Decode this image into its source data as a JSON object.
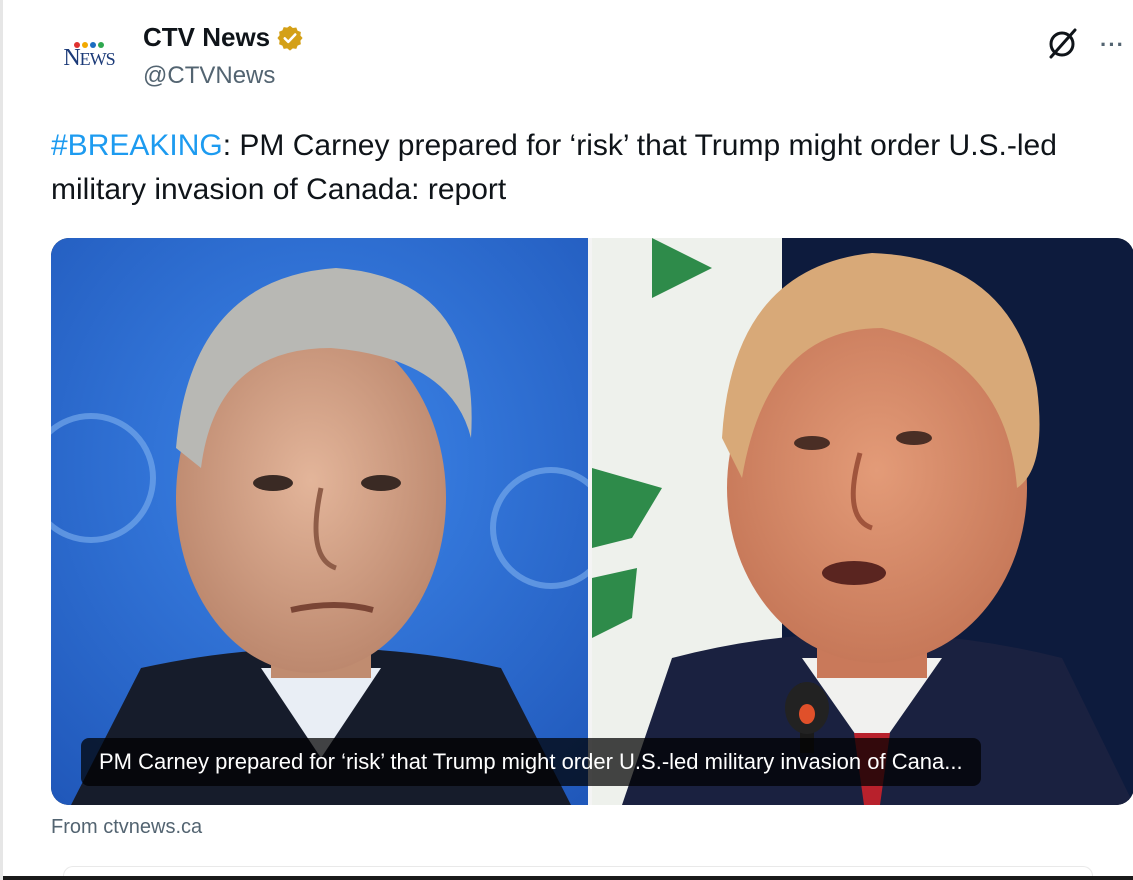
{
  "account": {
    "display_name": "CTV News",
    "handle": "@CTVNews",
    "avatar_text": "NEWS",
    "verified_color": "#d4a017"
  },
  "tweet": {
    "hashtag": "#BREAKING",
    "text": ": PM Carney prepared for ‘risk’ that Trump might order U.S.-led military invasion of Canada: report"
  },
  "card": {
    "caption": "PM Carney prepared for ‘risk’ that Trump might order U.S.-led military invasion of Cana...",
    "source": "From ctvnews.ca"
  },
  "icons": {
    "grok": "grok-icon",
    "more": "more-options-icon",
    "verified": "verified-badge-icon"
  },
  "colors": {
    "link": "#1d9bf0",
    "secondary_text": "#536471",
    "left_photo_bg": "#2f6fd6",
    "right_photo_bg": "#0d1b3d"
  }
}
